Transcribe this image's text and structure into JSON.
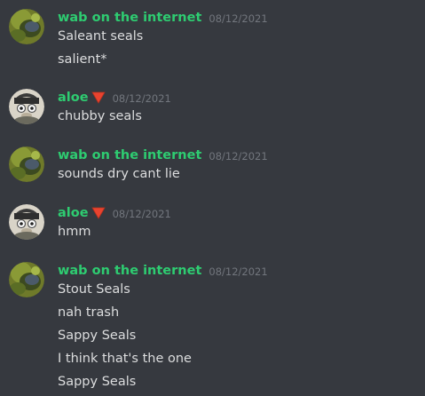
{
  "colors": {
    "background": "#36393f",
    "username_green": "#2ecc71",
    "username_aloe": "#2ecc71",
    "timestamp": "#72767d",
    "text": "#dcddde",
    "role_icon": "#e8432f"
  },
  "messages": [
    {
      "author": "wab on the internet",
      "timestamp": "08/12/2021",
      "avatar": "green-avatar",
      "lines": [
        "Saleant seals",
        "salient*"
      ]
    },
    {
      "author": "aloe",
      "timestamp": "08/12/2021",
      "avatar": "aloe-avatar",
      "role_icon": "red-triangle-icon",
      "lines": [
        "chubby seals"
      ]
    },
    {
      "author": "wab on the internet",
      "timestamp": "08/12/2021",
      "avatar": "green-avatar",
      "lines": [
        "sounds dry cant lie"
      ]
    },
    {
      "author": "aloe",
      "timestamp": "08/12/2021",
      "avatar": "aloe-avatar",
      "role_icon": "red-triangle-icon",
      "lines": [
        "hmm"
      ]
    },
    {
      "author": "wab on the internet",
      "timestamp": "08/12/2021",
      "avatar": "green-avatar",
      "lines": [
        "Stout Seals",
        "nah trash",
        "Sappy Seals",
        "I think that's the one",
        "Sappy Seals"
      ]
    }
  ]
}
